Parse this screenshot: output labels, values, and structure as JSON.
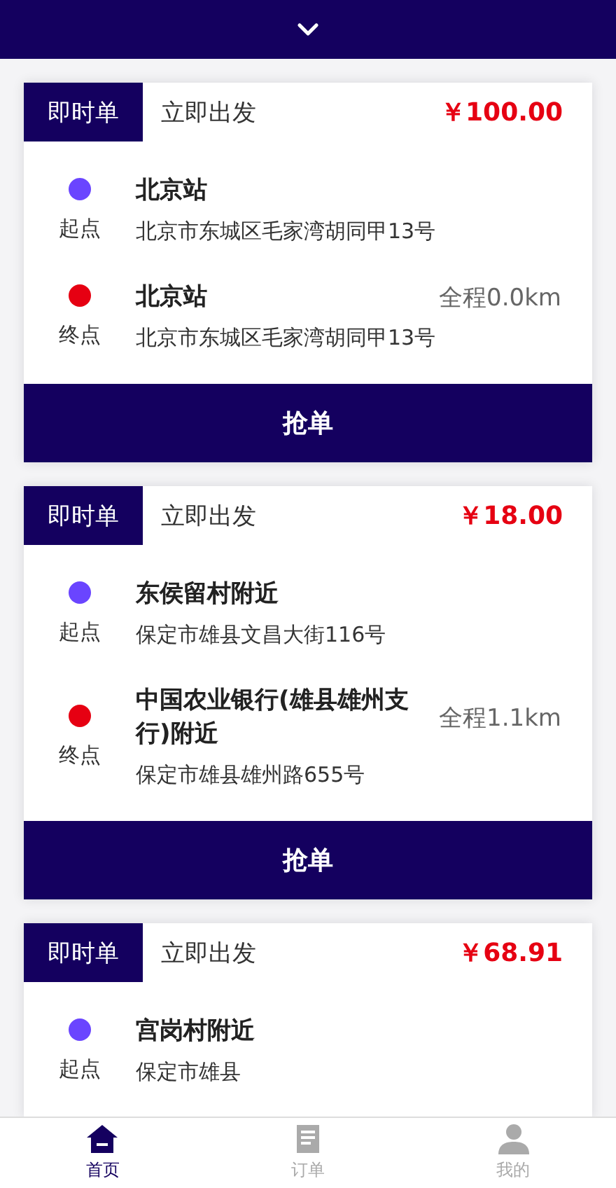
{
  "orders": [
    {
      "tag": "即时单",
      "timing": "立即出发",
      "price": "￥100.00",
      "stops": [
        {
          "color": "#6a45ff",
          "label": "起点",
          "name": "北京站",
          "address": "北京市东城区毛家湾胡同甲13号"
        },
        {
          "color": "#e60012",
          "label": "终点",
          "name": "北京站",
          "address": "北京市东城区毛家湾胡同甲13号",
          "distance": "全程0.0km"
        }
      ],
      "action": "抢单"
    },
    {
      "tag": "即时单",
      "timing": "立即出发",
      "price": "￥18.00",
      "stops": [
        {
          "color": "#6a45ff",
          "label": "起点",
          "name": "东侯留村附近",
          "address": "保定市雄县文昌大街116号"
        },
        {
          "color": "#e60012",
          "label": "终点",
          "name": "中国农业银行(雄县雄州支行)附近",
          "address": "保定市雄县雄州路655号",
          "distance": "全程1.1km"
        }
      ],
      "action": "抢单"
    },
    {
      "tag": "即时单",
      "timing": "立即出发",
      "price": "￥68.91",
      "stops": [
        {
          "color": "#6a45ff",
          "label": "起点",
          "name": "宫岗村附近",
          "address": "保定市雄县"
        }
      ]
    }
  ],
  "tab_bar": [
    {
      "label": "首页",
      "selected": true
    },
    {
      "label": "订单",
      "selected": false
    },
    {
      "label": "我的",
      "selected": false
    }
  ]
}
